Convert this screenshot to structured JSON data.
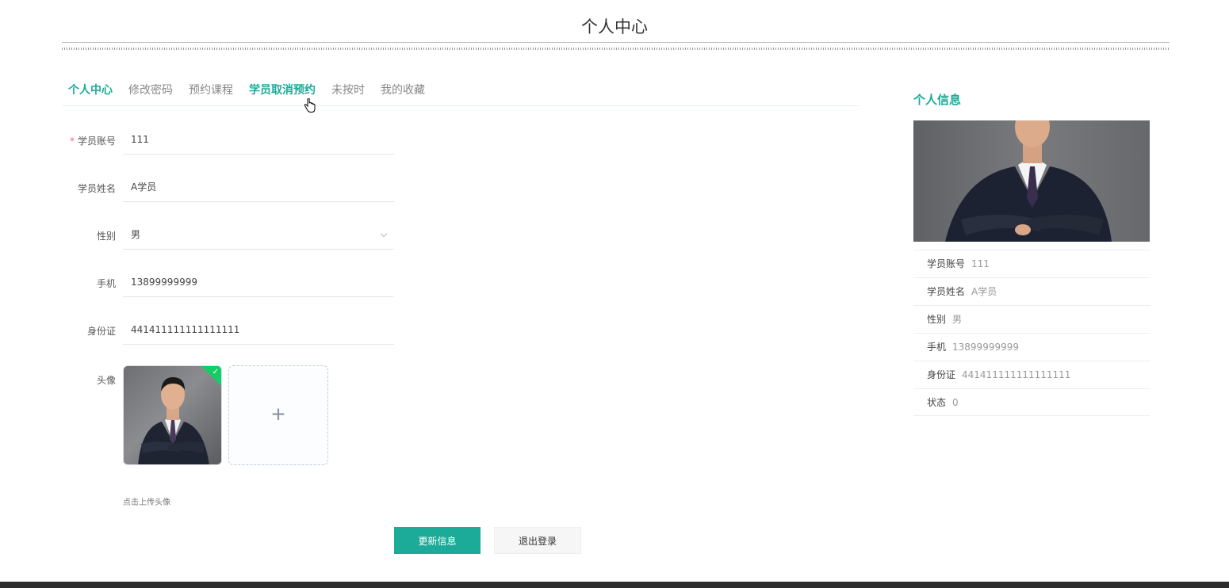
{
  "page": {
    "title": "个人中心"
  },
  "tabs": [
    {
      "label": "个人中心",
      "state": "active"
    },
    {
      "label": "修改密码",
      "state": "normal"
    },
    {
      "label": "预约课程",
      "state": "normal"
    },
    {
      "label": "学员取消预约",
      "state": "hover"
    },
    {
      "label": "未按时",
      "state": "normal"
    },
    {
      "label": "我的收藏",
      "state": "normal"
    }
  ],
  "form": {
    "account": {
      "label": "学员账号",
      "value": "111",
      "required": true
    },
    "name": {
      "label": "学员姓名",
      "value": "A学员"
    },
    "gender": {
      "label": "性别",
      "value": "男"
    },
    "phone": {
      "label": "手机",
      "value": "13899999999"
    },
    "id_card": {
      "label": "身份证",
      "value": "441411111111111111"
    },
    "avatar": {
      "label": "头像",
      "tip": "点击上传头像"
    }
  },
  "buttons": {
    "update": "更新信息",
    "logout": "退出登录"
  },
  "info_panel": {
    "title": "个人信息",
    "rows": [
      {
        "key": "学员账号",
        "value": "111"
      },
      {
        "key": "学员姓名",
        "value": "A学员"
      },
      {
        "key": "性别",
        "value": "男"
      },
      {
        "key": "手机",
        "value": "13899999999"
      },
      {
        "key": "身份证",
        "value": "441411111111111111"
      },
      {
        "key": "状态",
        "value": "0"
      }
    ]
  },
  "colors": {
    "accent": "#1bab98",
    "success": "#13ce66",
    "footer": "#2d2d2d"
  },
  "icons": {
    "upload": "plus-icon",
    "uploaded": "check-icon",
    "select": "chevron-down-icon",
    "pointer": "hand-cursor-icon"
  }
}
